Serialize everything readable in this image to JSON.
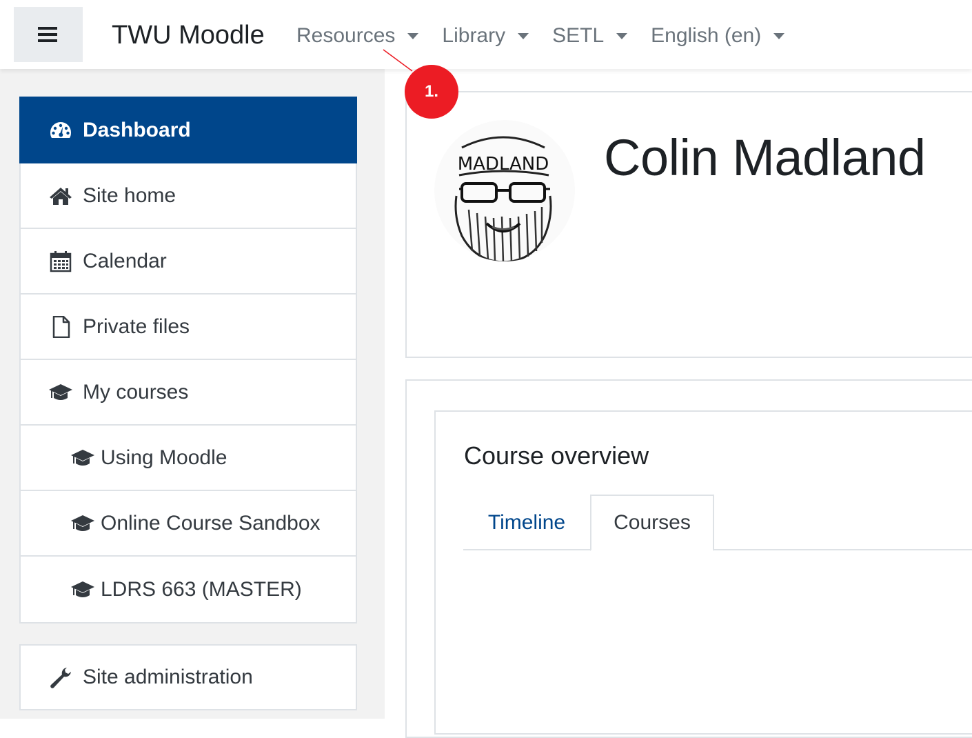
{
  "header": {
    "menu_toggle_icon": "hamburger-icon",
    "site_name": "TWU Moodle",
    "menus": [
      {
        "label": "Resources"
      },
      {
        "label": "Library"
      },
      {
        "label": "SETL"
      },
      {
        "label": "English (en)"
      }
    ]
  },
  "sidebar": {
    "items": [
      {
        "label": "Dashboard",
        "icon": "dashboard-icon",
        "active": true
      },
      {
        "label": "Site home",
        "icon": "home-icon"
      },
      {
        "label": "Calendar",
        "icon": "calendar-icon"
      },
      {
        "label": "Private files",
        "icon": "file-icon"
      },
      {
        "label": "My courses",
        "icon": "graduation-cap-icon"
      },
      {
        "label": "Using Moodle",
        "icon": "graduation-cap-icon"
      },
      {
        "label": "Online Course Sandbox",
        "icon": "graduation-cap-icon"
      },
      {
        "label": "LDRS 663 (MASTER)",
        "icon": "graduation-cap-icon"
      }
    ],
    "admin": {
      "label": "Site administration",
      "icon": "wrench-icon"
    }
  },
  "profile": {
    "name": "Colin Madland",
    "avatar_text": "MADLAND"
  },
  "annotation": {
    "step_label": "1.",
    "color": "#ec1c24"
  },
  "course_overview": {
    "title": "Course overview",
    "tabs": [
      {
        "label": "Timeline",
        "active": false
      },
      {
        "label": "Courses",
        "active": true
      }
    ]
  },
  "colors": {
    "brand_blue": "#00468b",
    "sidebar_bg": "#f2f2f2",
    "border": "#dee2e6",
    "nav_text": "#6a737b"
  }
}
